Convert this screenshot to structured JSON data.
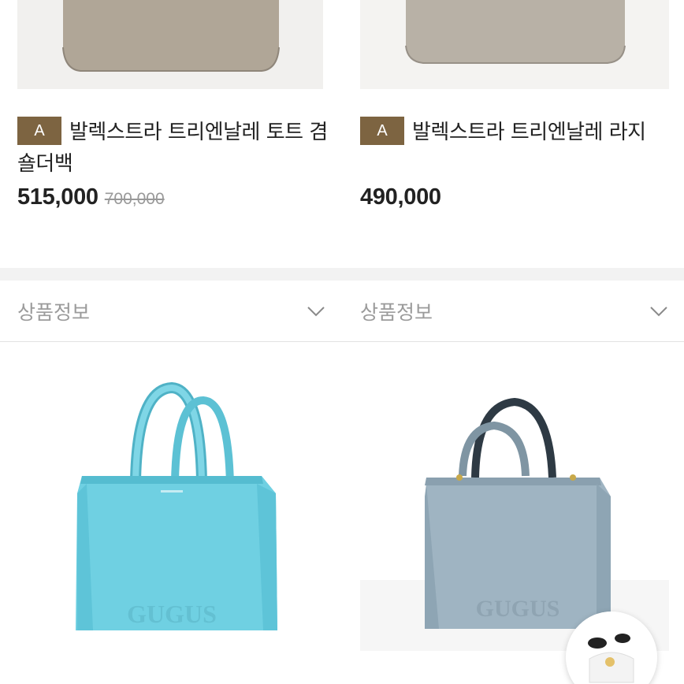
{
  "products": [
    {
      "grade": "A",
      "title": "발렉스트라 트리엔날레 토트 겸 숄더백",
      "price": "515,000",
      "original_price": "700,000",
      "info_label": "상품정보"
    },
    {
      "grade": "A",
      "title": "발렉스트라 트리엔날레 라지",
      "price": "490,000",
      "original_price": "",
      "info_label": "상품정보"
    }
  ],
  "bag_watermark": "GUGUS",
  "colors": {
    "badge": "#7d6441",
    "price": "#222222",
    "original_price": "#999999",
    "info_label": "#9b9b9b",
    "bag_left": "#6fcfe0",
    "bag_right": "#9fb3c0",
    "top_bags": "#b4ab9f"
  },
  "icons": [
    "chevron-down-icon",
    "chevron-down-icon",
    "floating-avatar-icon"
  ]
}
